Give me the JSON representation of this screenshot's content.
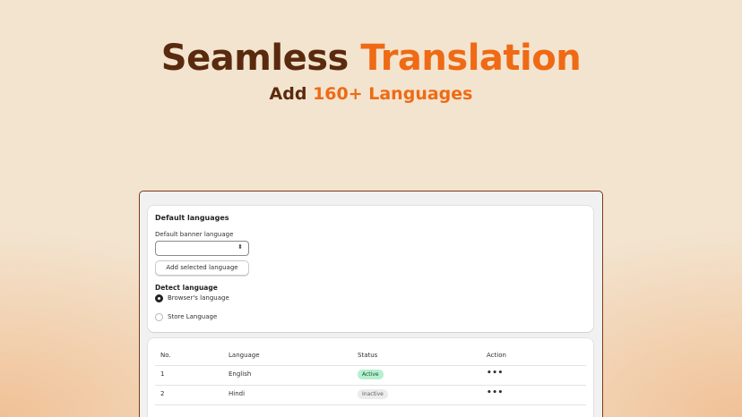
{
  "hero": {
    "title_part1": "Seamless",
    "title_part2": "Translation",
    "subtitle_part1": "Add",
    "subtitle_part2": "160+ Languages"
  },
  "default_languages": {
    "section_title": "Default languages",
    "banner_label": "Default banner language",
    "banner_value": "",
    "add_button": "Add selected language",
    "detect_title": "Detect language",
    "options": [
      {
        "label": "Browser's language",
        "checked": true
      },
      {
        "label": "Store Language",
        "checked": false
      }
    ]
  },
  "table": {
    "headers": [
      "No.",
      "Language",
      "Status",
      "Action"
    ],
    "rows": [
      {
        "no": "1",
        "language": "English",
        "status": "Active",
        "action": "•••"
      },
      {
        "no": "2",
        "language": "Hindi",
        "status": "Inactive",
        "action": "•••"
      }
    ]
  },
  "colors": {
    "brand_dark": "#5a2a0e",
    "brand_accent": "#ef6a14",
    "active_badge": "#b6f0cf",
    "inactive_badge": "#ececec"
  },
  "icons": {
    "select_chevron": "select-chevron-icon",
    "row_action": "more-horizontal-icon"
  }
}
